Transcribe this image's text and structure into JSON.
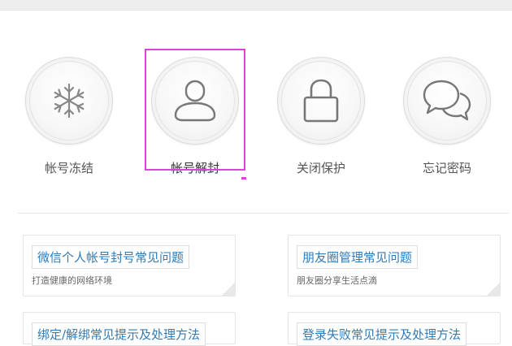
{
  "services": [
    {
      "label": "帐号冻结",
      "icon": "snowflake-icon"
    },
    {
      "label": "帐号解封",
      "icon": "user-icon"
    },
    {
      "label": "关闭保护",
      "icon": "lock-icon"
    },
    {
      "label": "忘记密码",
      "icon": "chat-bubbles-icon"
    }
  ],
  "faq": [
    {
      "title": "微信个人帐号封号常见问题",
      "desc": "打造健康的网络环境"
    },
    {
      "title": "朋友圈管理常见问题",
      "desc": "朋友圈分享生活点滴"
    },
    {
      "title": "绑定/解绑常见提示及处理方法",
      "desc": ""
    },
    {
      "title": "登录失败常见提示及处理方法",
      "desc": ""
    }
  ],
  "colors": {
    "link": "#2f7bb8",
    "highlight": "#e040e0",
    "icon_stroke": "#777777"
  }
}
